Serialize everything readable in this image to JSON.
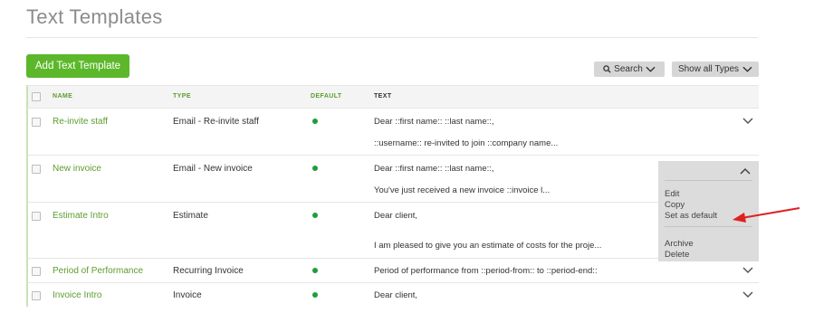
{
  "page": {
    "title": "Text Templates"
  },
  "toolbar": {
    "add_label": "Add Text Template",
    "search_label": "Search",
    "types_label": "Show all Types"
  },
  "table": {
    "headers": {
      "name": "NAME",
      "type": "TYPE",
      "default": "DEFAULT",
      "text": "TEXT"
    },
    "rows": [
      {
        "name": "Re-invite staff",
        "type": "Email - Re-invite staff",
        "default": true,
        "text1": "Dear ::first name:: ::last name::,",
        "text2": "::username:: re-invited to join ::company name..."
      },
      {
        "name": "New invoice",
        "type": "Email - New invoice",
        "default": true,
        "text1": "Dear ::first name:: ::last name::,",
        "text2": "You've just received a new invoice ::invoice l..."
      },
      {
        "name": "Estimate Intro",
        "type": "Estimate",
        "default": true,
        "text1": "Dear client,",
        "text2": "I am pleased to give you an estimate of costs for the proje..."
      },
      {
        "name": "Period of Performance",
        "type": "Recurring Invoice",
        "default": true,
        "text1": "Period of performance from ::period-from:: to ::period-end::"
      },
      {
        "name": "Invoice Intro",
        "type": "Invoice",
        "default": true,
        "text1": "Dear client,"
      }
    ]
  },
  "actions_menu": {
    "items": [
      "Edit",
      "Copy",
      "Set as default",
      "Archive",
      "Delete"
    ]
  },
  "colors": {
    "accent": "#5cb82a",
    "link": "#5d9c2e",
    "default_dot": "#1d9e3a",
    "annotation_arrow": "#e02020"
  }
}
